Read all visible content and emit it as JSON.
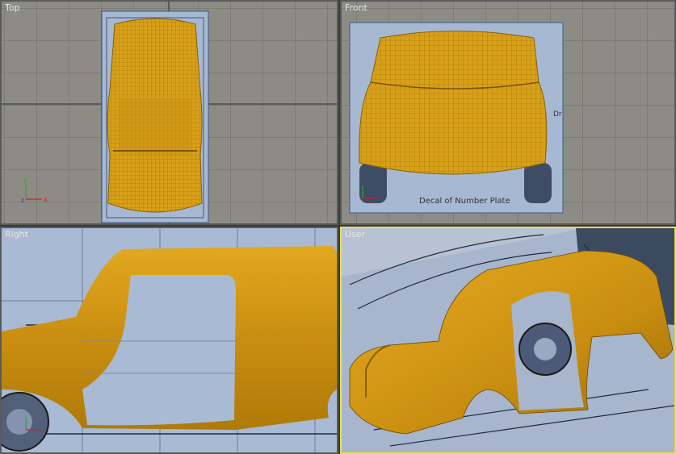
{
  "viewports": {
    "top": {
      "label": "Top"
    },
    "front": {
      "label": "Front",
      "decal_text": "Decal of Number Plate",
      "side_mark": "Dr"
    },
    "right": {
      "label": "Right"
    },
    "user": {
      "label": "User"
    }
  },
  "axis": {
    "x": "x",
    "y": "y",
    "z": "z"
  },
  "colors": {
    "grid_bg": "#8f8f87",
    "grid_line": "#6e6e68",
    "blueprint": "#9fb3cf",
    "car_body": "#d9a019",
    "wire": "#8a6200",
    "active_border": "#e8e04a"
  }
}
